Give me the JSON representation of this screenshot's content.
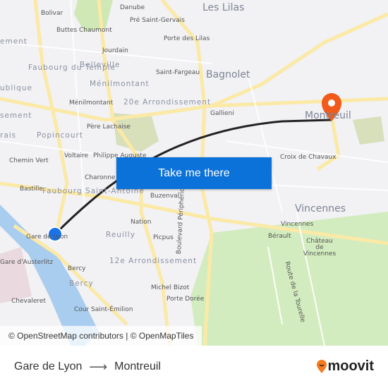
{
  "map": {
    "labels": [
      "Bolivar",
      "Danube",
      "Pré Saint-Gervais",
      "Buttes Chaumont",
      "Porte des Lilas",
      "Jourdain",
      "Saint-Fargeau",
      "Ménilmontant",
      "Gallieni",
      "Père Lachaise",
      "Voltaire",
      "Philippe Auguste",
      "Chemin Vert",
      "Bastille",
      "Charonne",
      "Buzenval",
      "Croix de Chavaux",
      "Gare de Lyon",
      "Nation",
      "Picpus",
      "Vincennes",
      "Bérault",
      "Château de Vincennes",
      "Gare d'Austerlitz",
      "Bercy",
      "Chevaleret",
      "Michel Bizot",
      "Cour Saint-Émilion",
      "Porte Dorée",
      "Boulevard Périphérique",
      "Route de la Tourelle"
    ],
    "districts": [
      "Faubourg du Temple",
      "Belleville",
      "Ménilmontant",
      "20e Arrondissement",
      "Popincourt",
      "Faubourg Saint-Antoine",
      "Reuilly",
      "12e Arrondissement",
      "Bercy",
      "ublique",
      "ement",
      "sement",
      "rais"
    ],
    "cities": [
      "Les Lilas",
      "Bagnolet",
      "Montreuil",
      "Vincennes"
    ]
  },
  "route": {
    "color": "#222222",
    "origin_color": "#1a73e8",
    "destination_color": "#f05a1a"
  },
  "cta": {
    "label": "Take me there"
  },
  "attribution": "© OpenStreetMap contributors | © OpenMapTiles",
  "footer": {
    "from": "Gare de Lyon",
    "to": "Montreuil",
    "arrow": "⟶",
    "logo": "moovit"
  }
}
